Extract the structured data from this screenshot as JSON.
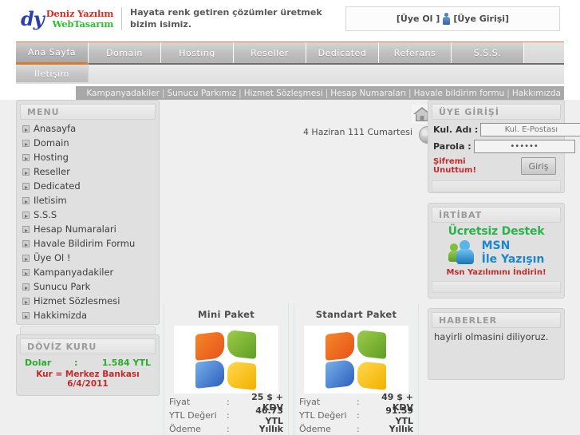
{
  "header": {
    "logo": {
      "mark": "dy",
      "line1": "Deniz Yazılım",
      "line2": "WebTasarım"
    },
    "slogan": "Hayata renk getiren çözümler üretmek bizim isimiz.",
    "member_signup": "[Üye Ol ]",
    "member_login": "[Üye Girişi]",
    "person_icon": "person-icon"
  },
  "nav": {
    "row1": [
      "Ana Sayfa",
      "Domain",
      "Hosting",
      "Reseller",
      "Dedicated",
      "Referans",
      "S.S.S."
    ],
    "row2": [
      "İletişim"
    ],
    "active": "Ana Sayfa"
  },
  "breadcrumb": {
    "items": [
      "Kampanyadakiler",
      "Sunucu Parkımız",
      "Hizmet Sözleşmesi",
      "Hesap Numaraları",
      "Havale bildirim formu",
      "Hakkımızda"
    ],
    "separator": "|"
  },
  "sidebar_left": {
    "menu": {
      "title": "MENU",
      "items": [
        "Anasayfa",
        "Domain",
        "Hosting",
        "Reseller",
        "Dedicated",
        "Iletisim",
        "S.S.S",
        "Hesap Numaralari",
        "Havale Bildirim Formu",
        "Üye Ol !",
        "Kampanyadakiler",
        "Sunucu Park",
        "Hizmet Sözlesmesi",
        "Hakkimizda"
      ]
    },
    "doviz": {
      "title": "DÖVİZ KURU",
      "currency_label": "Dolar",
      "colon": ":",
      "currency_value": "1.584 YTL",
      "note": "Kur = Merkez Bankası 6/4/2011",
      "value_color": "#2eaa2e",
      "note_color": "#c02b2b"
    }
  },
  "main": {
    "date": "4 Haziran 111 Cumartesi",
    "home_icon": "home-icon",
    "globe_icon": "globe-icon",
    "packages": [
      {
        "title": "Mini Paket",
        "logo": "windows-logo-icon",
        "rows": [
          {
            "label": "Fiyat",
            "colon": ":",
            "value": "25 $ + KDV"
          },
          {
            "label": "YTL Değeri",
            "colon": ":",
            "value": "46.73 YTL"
          },
          {
            "label": "Ödeme",
            "colon": ":",
            "value": "Yıllık"
          }
        ]
      },
      {
        "title": "Standart Paket",
        "logo": "windows-logo-icon",
        "rows": [
          {
            "label": "Fiyat",
            "colon": ":",
            "value": "49 $ + KDV"
          },
          {
            "label": "YTL Değeri",
            "colon": ":",
            "value": "91.59 YTL"
          },
          {
            "label": "Ödeme",
            "colon": ":",
            "value": "Yıllık"
          }
        ]
      }
    ]
  },
  "sidebar_right": {
    "login": {
      "title": "ÜYE GİRİŞİ",
      "user_label": "Kul. Adı :",
      "user_placeholder": "Kul. E-Postası",
      "user_value": "",
      "pass_label": "Parola :",
      "pass_value": "••••••",
      "forgot_line1": "Şifremi",
      "forgot_line2": "Unuttum!",
      "submit_label": "Giriş"
    },
    "irtibat": {
      "title": "İRTİBAT",
      "line1": "Ücretsiz Destek",
      "line2": "MSN",
      "line3": "İle Yazışın",
      "line4": "Msn Yazılımını İndirin!",
      "icon": "msn-contacts-icon",
      "color1": "#2bb24c",
      "color2": "#1c86d0",
      "color4": "#c02b2b"
    },
    "haberler": {
      "title": "HABERLER",
      "text": "hayirli olmasini diliyoruz."
    }
  },
  "colors": {
    "accent_orange": "#d77b38",
    "page_bg": "#efefef",
    "panel_bg": "#e0e0e0",
    "crumb_bg": "#a8a8a8"
  }
}
